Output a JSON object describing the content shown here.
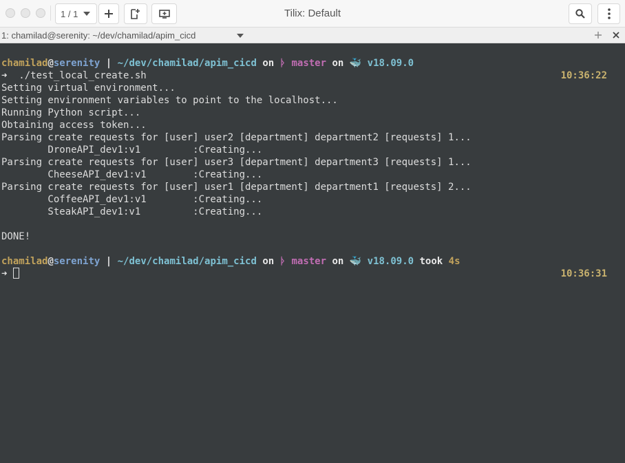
{
  "window": {
    "title": "Tilix: Default",
    "session_counter": "1 / 1"
  },
  "tab": {
    "label": "1: chamilad@serenity: ~/dev/chamilad/apim_cicd"
  },
  "prompt1": {
    "user": "chamilad",
    "at": "@",
    "host": "serenity",
    "sep": " | ",
    "path": "~/dev/chamilad/apim_cicd",
    "on1": " on ",
    "branch_glyph": "ᚦ",
    "branch": "master",
    "on2": " on ",
    "docker_glyph": "🐳",
    "version": "v18.09.0",
    "arrow": "➜",
    "command": "./test_local_create.sh",
    "time": "10:36:22"
  },
  "output": [
    "Setting virtual environment...",
    "Setting environment variables to point to the localhost...",
    "Running Python script...",
    "Obtaining access token...",
    "Parsing create requests for [user] user2 [department] department2 [requests] 1...",
    "        DroneAPI_dev1:v1         :Creating...",
    "Parsing create requests for [user] user3 [department] department3 [requests] 1...",
    "        CheeseAPI_dev1:v1        :Creating...",
    "Parsing create requests for [user] user1 [department] department1 [requests] 2...",
    "        CoffeeAPI_dev1:v1        :Creating...",
    "        SteakAPI_dev1:v1         :Creating...",
    "",
    "DONE!"
  ],
  "prompt2": {
    "user": "chamilad",
    "at": "@",
    "host": "serenity",
    "sep": " | ",
    "path": "~/dev/chamilad/apim_cicd",
    "on1": " on ",
    "branch_glyph": "ᚦ",
    "branch": "master",
    "on2": " on ",
    "docker_glyph": "🐳",
    "version": "v18.09.0",
    "took_label": " took ",
    "took_value": "4s",
    "arrow": "➜",
    "time": "10:36:31"
  },
  "colors": {
    "terminal_bg": "#383c3e",
    "user": "#c2a35c",
    "host": "#7ea3d1",
    "path": "#7ec1d3",
    "branch": "#c16db3",
    "time": "#c9b26e"
  }
}
